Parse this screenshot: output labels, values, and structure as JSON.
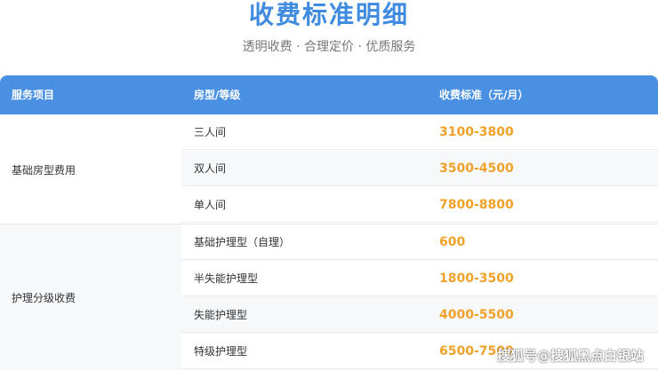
{
  "header": {
    "title": "收费标准明细",
    "subtitle": "透明收费 · 合理定价 · 优质服务"
  },
  "table": {
    "columns": [
      "服务项目",
      "房型/等级",
      "收费标准（元/月）"
    ],
    "groups": [
      {
        "label": "基础房型费用",
        "rows": [
          {
            "type": "三人间",
            "price": "3100-3800"
          },
          {
            "type": "双人间",
            "price": "3500-4500"
          },
          {
            "type": "单人间",
            "price": "7800-8800"
          }
        ]
      },
      {
        "label": "护理分级收费",
        "rows": [
          {
            "type": "基础护理型（自理）",
            "price": "600"
          },
          {
            "type": "半失能护理型",
            "price": "1800-3500"
          },
          {
            "type": "失能护理型",
            "price": "4000-5500"
          },
          {
            "type": "特级护理型",
            "price": "6500-7500"
          }
        ]
      }
    ]
  },
  "watermark": "搜狐号@搜狐黑点白银站",
  "colors": {
    "accent": "#4a90e2",
    "title": "#3f8be0",
    "price": "#f0a12a"
  }
}
